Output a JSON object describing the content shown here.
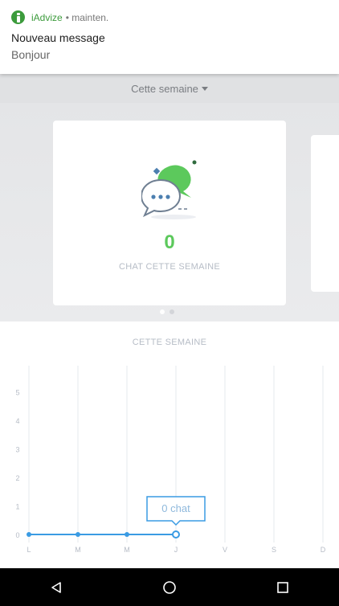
{
  "notification": {
    "app_name": "iAdvize",
    "meta": "• mainten.",
    "title": "Nouveau message",
    "body": "Bonjour"
  },
  "period": {
    "label": "Cette semaine"
  },
  "card": {
    "count": "0",
    "caption": "CHAT CETTE SEMAINE"
  },
  "carousel": {
    "pages": 2,
    "active": 0
  },
  "chart_section": {
    "title": "CETTE SEMAINE"
  },
  "chart_data": {
    "type": "line",
    "categories": [
      "L",
      "M",
      "M",
      "J",
      "V",
      "S",
      "D"
    ],
    "series": [
      {
        "values": [
          0,
          0,
          0,
          0
        ]
      }
    ],
    "y_ticks": [
      "0",
      "1",
      "2",
      "3",
      "4",
      "5"
    ],
    "ylim": [
      0,
      5
    ],
    "tooltip": {
      "category_index": 3,
      "text": "0 chat"
    },
    "color": "#3a9be3",
    "grid": true
  },
  "colors": {
    "accent_green": "#5cc95c",
    "line_blue": "#3a9be3",
    "app_green": "#3c9b3c"
  },
  "navbar": {
    "icons": [
      "back-icon",
      "home-icon",
      "recents-icon"
    ]
  }
}
